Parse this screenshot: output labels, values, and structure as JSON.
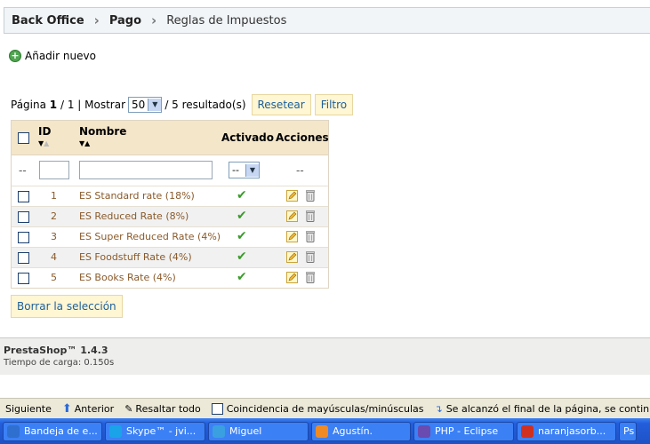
{
  "breadcrumb": {
    "item1": "Back Office",
    "item2": "Pago",
    "item3": "Reglas de Impuestos"
  },
  "actions": {
    "add_new": "Añadir nuevo"
  },
  "pagination": {
    "page_label": "Página",
    "current": "1",
    "total": "1",
    "show_label": "| Mostrar",
    "per_page": "50",
    "results": "/ 5 resultado(s)"
  },
  "buttons": {
    "reset": "Resetear",
    "filter": "Filtro",
    "delete_selection": "Borrar la selección"
  },
  "table": {
    "headers": {
      "id": "ID",
      "name": "Nombre",
      "active": "Activado",
      "actions": "Acciones"
    },
    "filter": {
      "id_dash": "--",
      "active_value": "--",
      "actions_dash": "--"
    },
    "rows": [
      {
        "id": "1",
        "name": "ES Standard rate (18%)",
        "active": true
      },
      {
        "id": "2",
        "name": "ES Reduced Rate (8%)",
        "active": true
      },
      {
        "id": "3",
        "name": "ES Super Reduced Rate (4%)",
        "active": true
      },
      {
        "id": "4",
        "name": "ES Foodstuff Rate (4%)",
        "active": true
      },
      {
        "id": "5",
        "name": "ES Books Rate (4%)",
        "active": true
      }
    ]
  },
  "footer": {
    "version": "PrestaShop™ 1.4.3",
    "load_time": "Tiempo de carga: 0.150s"
  },
  "findbar": {
    "next": "Siguiente",
    "previous": "Anterior",
    "highlight": "Resaltar todo",
    "match_case": "Coincidencia de mayúsculas/minúsculas",
    "status": "Se alcanzó el final de la página, se continúa desde el pri"
  },
  "taskbar": {
    "items": [
      "Bandeja de e...",
      "Skype™ - jvi...",
      "Miguel",
      "Agustín.",
      "PHP - Eclipse",
      "naranjasorb...",
      "Ps"
    ]
  },
  "colors": {
    "header_bg": "#f4e6c9",
    "link": "#8a5a2a",
    "button_bg": "#fff6d3",
    "taskbar": "#245edb"
  }
}
